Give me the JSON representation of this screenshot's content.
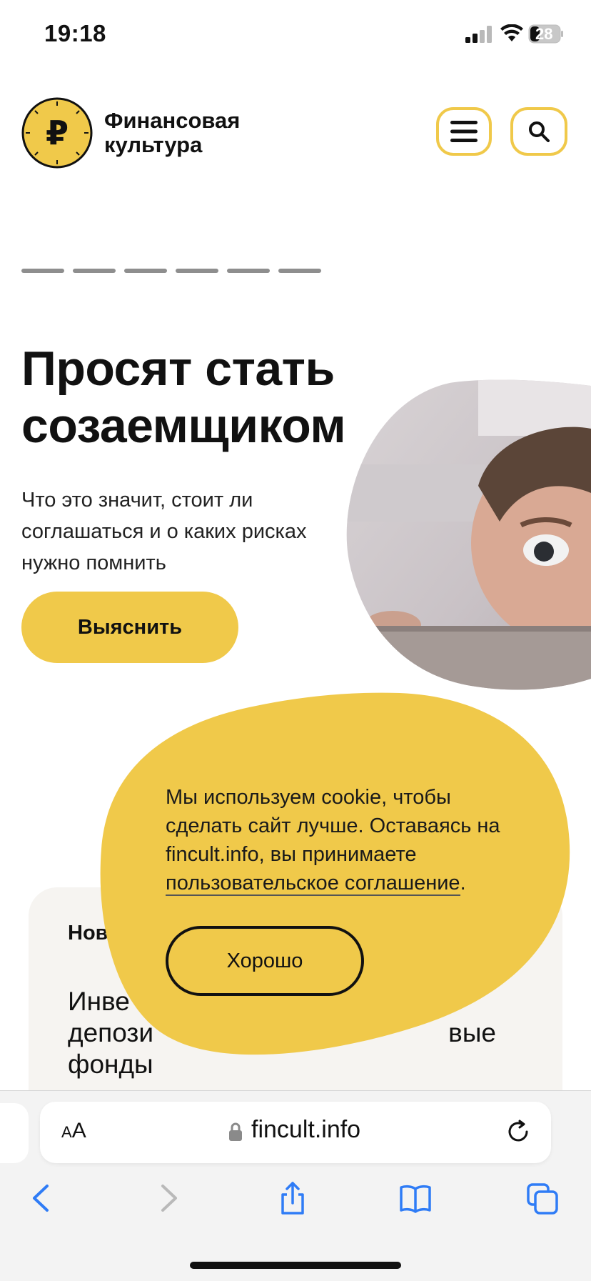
{
  "status_bar": {
    "time": "19:18",
    "battery": "28"
  },
  "header": {
    "brand_line1": "Финансовая",
    "brand_line2": "культура",
    "logo_icon": "ruble-clock-logo",
    "menu_icon": "hamburger-icon",
    "search_icon": "search-icon"
  },
  "slider": {
    "total": 6,
    "active": 1
  },
  "hero": {
    "title_line1": "Просят стать",
    "title_line2": "созаемщиком",
    "subtitle": "Что это значит, стоит ли соглашаться и о каких рисках нужно помнить",
    "cta_label": "Выяснить"
  },
  "news_card": {
    "label": "Нов",
    "title_line1": "Инве",
    "title_line2_left": "депози",
    "title_line2_right": "вые",
    "title_line3": "фонды"
  },
  "cookie": {
    "text_before": "Мы используем cookie, чтобы сделать сайт лучше. Оставаясь на fincult.info, вы принимаете ",
    "link": "пользовательское соглашение",
    "text_after": ".",
    "button": "Хорошо"
  },
  "browser": {
    "aa_small": "A",
    "aa_large": "A",
    "url": "fincult.info"
  },
  "colors": {
    "accent": "#f0c94a",
    "text": "#111111"
  }
}
